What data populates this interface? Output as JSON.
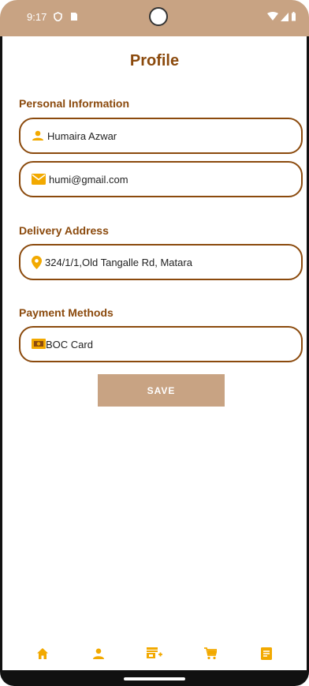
{
  "status_bar": {
    "time": "9:17",
    "left_icons": [
      "vpn-icon",
      "sim-card-icon"
    ],
    "right_icons": [
      "wifi-icon",
      "signal-icon",
      "battery-icon"
    ]
  },
  "header": {
    "title": "Profile"
  },
  "personal": {
    "section_label": "Personal Information",
    "name_value": "Humaira Azwar",
    "name_icon": "person-icon",
    "email_value": "humi@gmail.com",
    "email_icon": "mail-icon"
  },
  "delivery": {
    "section_label": "Delivery Address",
    "address_value": "324/1/1,Old Tangalle Rd, Matara",
    "address_icon": "location-pin-icon"
  },
  "payment": {
    "section_label": "Payment Methods",
    "method_value": "BOC Card",
    "method_icon": "payment-card-icon"
  },
  "actions": {
    "save_label": "SAVE"
  },
  "bottom_nav": {
    "items": [
      "home-icon",
      "profile-icon",
      "add-store-icon",
      "cart-icon",
      "orders-icon"
    ]
  },
  "colors": {
    "accent": "#8b4a0d",
    "status_bar": "#c8a383",
    "button": "#c8a383",
    "icon": "#f2a900"
  }
}
